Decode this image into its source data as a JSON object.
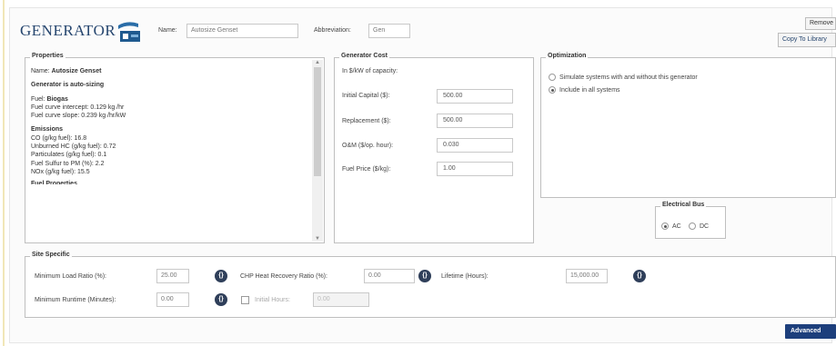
{
  "header": {
    "brand": "GENERATOR",
    "name_label": "Name:",
    "name_value": "Autosize Genset",
    "abbr_label": "Abbreviation:",
    "abbr_value": "Gen",
    "remove_label": "Remove",
    "copy_label": "Copy To Library"
  },
  "properties": {
    "title": "Properties",
    "name_prefix": "Name:",
    "name_value": "Autosize Genset",
    "autosize": "Generator is auto-sizing",
    "fuel_prefix": "Fuel:",
    "fuel_value": "Biogas",
    "intercept": "Fuel curve intercept:  0.129 kg /hr",
    "slope": "Fuel curve slope:  0.239 kg /hr/kW",
    "emissions_title": "Emissions",
    "emissions": [
      "CO (g/kg fuel): 16.8",
      "Unburned HC (g/kg fuel): 0.72",
      "Particulates (g/kg fuel): 0.1",
      "Fuel Sulfur to PM (%):  2.2",
      "NOx (g/kg fuel): 15.5"
    ],
    "cutoff": "Fuel Properties"
  },
  "cost": {
    "title": "Generator Cost",
    "subtitle": "In $/kW of capacity:",
    "rows": [
      {
        "label": "Initial Capital ($):",
        "value": "500.00"
      },
      {
        "label": "Replacement ($):",
        "value": "500.00"
      },
      {
        "label": "O&M ($/op. hour):",
        "value": "0.030"
      },
      {
        "label": "Fuel Price ($/kg):",
        "value": "1.00"
      }
    ]
  },
  "optimization": {
    "title": "Optimization",
    "option1": "Simulate systems with and without this generator",
    "option2": "Include in all systems",
    "selected": 2
  },
  "bus": {
    "title": "Electrical Bus",
    "ac": "AC",
    "dc": "DC",
    "selected": "AC"
  },
  "site": {
    "title": "Site Specific",
    "min_load_label": "Minimum Load Ratio (%):",
    "min_load_value": "25.00",
    "chp_label": "CHP Heat Recovery Ratio (%):",
    "chp_value": "0.00",
    "lifetime_label": "Lifetime (Hours):",
    "lifetime_value": "15,000.00",
    "min_runtime_label": "Minimum Runtime (Minutes):",
    "min_runtime_value": "0.00",
    "initial_hours_label": "Initial Hours:",
    "initial_hours_value": "0.00"
  },
  "advanced_label": "Advanced"
}
